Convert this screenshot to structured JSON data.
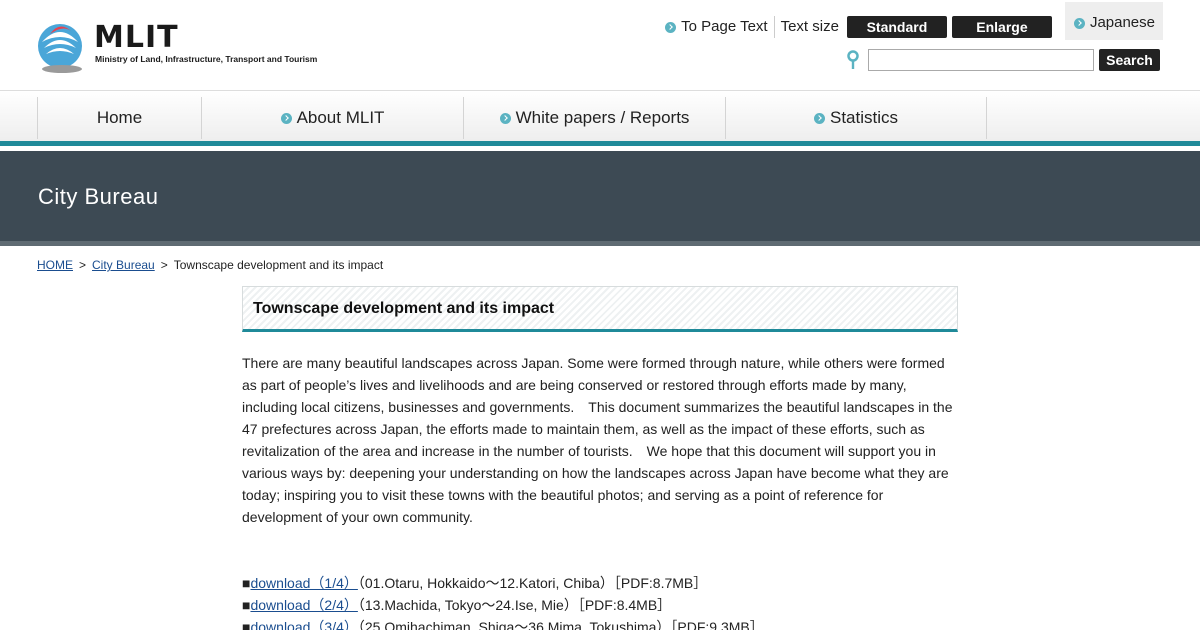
{
  "header": {
    "logo_text": "MLIT",
    "logo_subtitle": "Ministry of Land, Infrastructure, Transport and Tourism",
    "to_page_text": "To Page Text",
    "text_size_label": "Text size",
    "standard_label": "Standard",
    "enlarge_label": "Enlarge",
    "language_label": "Japanese",
    "search_value": "",
    "search_button": "Search"
  },
  "nav": {
    "items": [
      {
        "label": "Home"
      },
      {
        "label": "About MLIT"
      },
      {
        "label": "White papers / Reports"
      },
      {
        "label": "Statistics"
      },
      {
        "label": ""
      }
    ]
  },
  "banner": {
    "title": "City Bureau"
  },
  "breadcrumb": {
    "home": "HOME",
    "sep1": ">",
    "city_bureau": "City Bureau",
    "sep2": ">",
    "current": "Townscape development and its impact"
  },
  "main": {
    "title": "Townscape development and its impact",
    "intro": "There are many beautiful landscapes across Japan. Some were formed through nature, while others were formed as part of people’s lives and livelihoods and are being conserved or restored through efforts made by many, including local citizens, businesses and governments.　This document summarizes the beautiful landscapes in the 47 prefectures across Japan, the efforts made to maintain them, as well as the impact of these efforts, such as revitalization of the area and increase in the number of tourists.　We hope that this document will support you in various ways by: deepening your understanding on how the landscapes across Japan have become what they are today; inspiring you to visit these towns with the beautiful photos; and serving as a point of reference for development of your own community.",
    "downloads": [
      {
        "bullet": "■",
        "link": "download（1/4）",
        "desc": "（01.Otaru, Hokkaido～12.Katori, Chiba）［PDF:8.7MB］"
      },
      {
        "bullet": "■",
        "link": "download（2/4）",
        "desc": "（13.Machida, Tokyo～24.Ise, Mie）［PDF:8.4MB］"
      },
      {
        "bullet": "■",
        "link": "download（3/4）",
        "desc": "（25.Omihachiman, Shiga～36.Mima, Tokushima）［PDF:9.3MB］"
      }
    ]
  },
  "colors": {
    "accent_teal": "#1f8a99",
    "banner_bg": "#3d4a54",
    "link_blue": "#1a4d8f",
    "button_dark": "#222222"
  }
}
